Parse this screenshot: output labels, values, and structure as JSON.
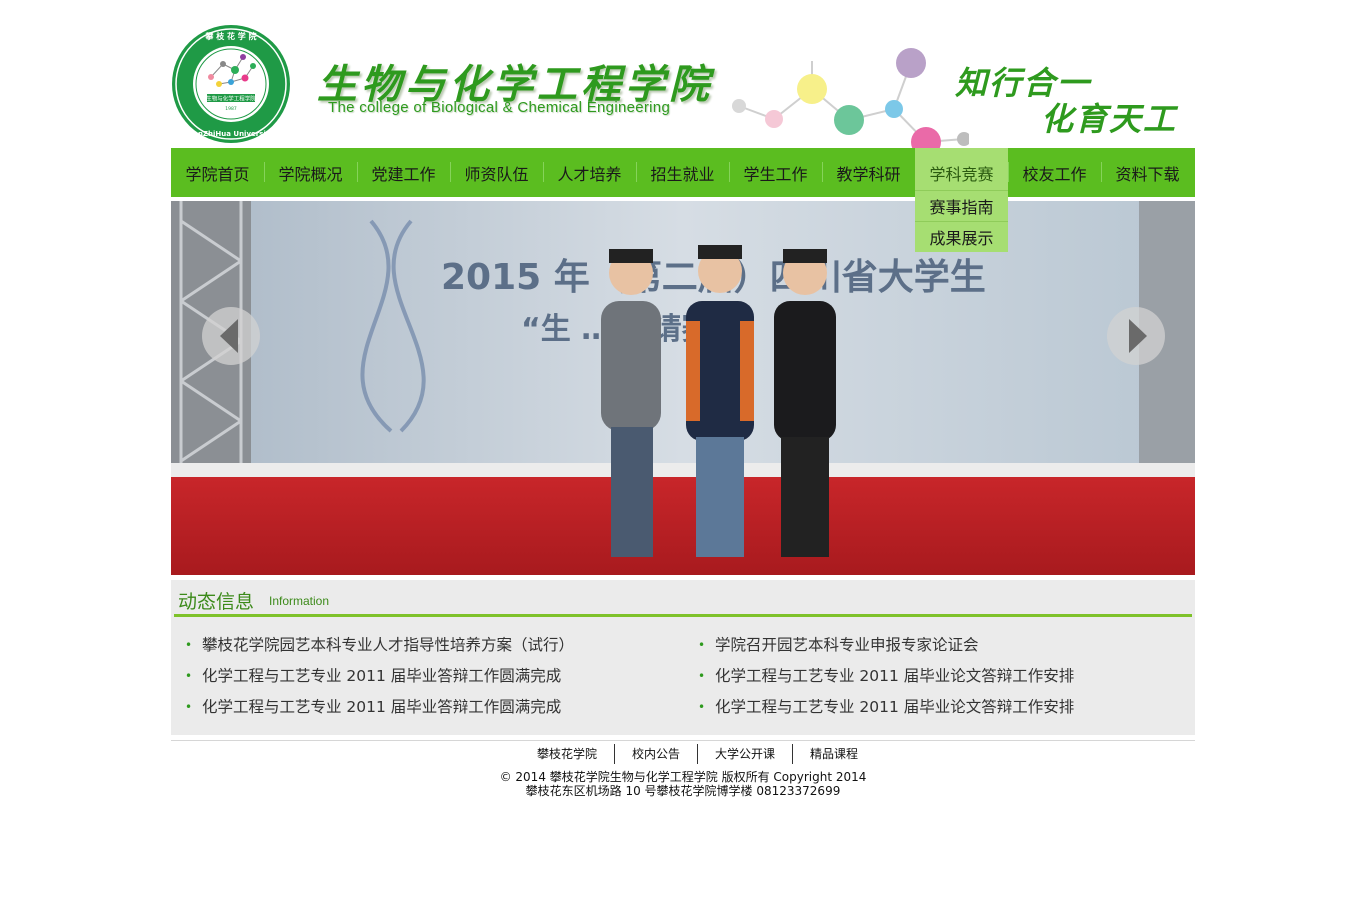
{
  "header": {
    "logo_top_text": "攀 枝 花 学 院",
    "logo_side_text": "PanZhiHua University",
    "logo_center_text": "生物与化学工程学院",
    "logo_year": "1987",
    "title_cn": "生物与化学工程学院",
    "title_en": "The college of Biological & Chemical Engineering",
    "motto_line1": "知行合一",
    "motto_line2": "化育天工",
    "accent_color": "#2e9a1e"
  },
  "nav": {
    "items": [
      {
        "label": "学院首页"
      },
      {
        "label": "学院概况"
      },
      {
        "label": "党建工作"
      },
      {
        "label": "师资队伍"
      },
      {
        "label": "人才培养"
      },
      {
        "label": "招生就业"
      },
      {
        "label": "学生工作"
      },
      {
        "label": "教学科研"
      },
      {
        "label": "学科竞赛",
        "active": true
      },
      {
        "label": "校友工作"
      },
      {
        "label": "资料下载"
      }
    ],
    "dropdown": [
      {
        "label": "赛事指南"
      },
      {
        "label": "成果展示"
      }
    ],
    "bg_color": "#5bbd20",
    "active_color": "#a6de72"
  },
  "banner": {
    "backdrop_text_line1": "2015 年（第二届）四川省大学生",
    "backdrop_text_line2": "“生 … 邀请赛”",
    "prev_icon": "chevron-left-icon",
    "next_icon": "chevron-right-icon"
  },
  "news": {
    "title": "动态信息",
    "subtitle": "Information",
    "left": [
      "攀枝花学院园艺本科专业人才指导性培养方案（试行）",
      "化学工程与工艺专业 2011 届毕业答辩工作圆满完成",
      "化学工程与工艺专业 2011 届毕业答辩工作圆满完成"
    ],
    "right": [
      "学院召开园艺本科专业申报专家论证会",
      "化学工程与工艺专业 2011 届毕业论文答辩工作安排",
      "化学工程与工艺专业 2011 届毕业论文答辩工作安排"
    ]
  },
  "footer": {
    "links": [
      "攀枝花学院",
      "校内公告",
      "大学公开课",
      "精品课程"
    ],
    "copyright": "© 2014 攀枝花学院生物与化学工程学院 版权所有 Copyright 2014",
    "address": "攀枝花东区机场路 10 号攀枝花学院博学楼 08123372699"
  }
}
